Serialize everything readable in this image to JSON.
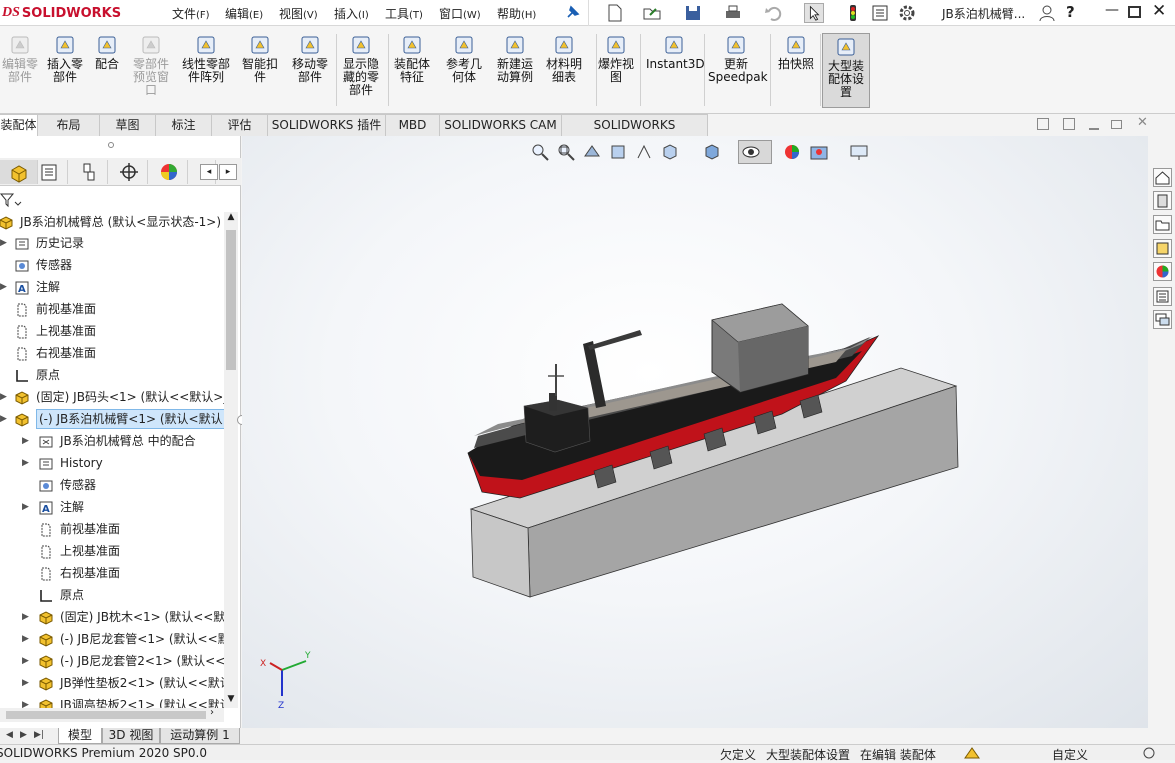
{
  "app": {
    "logo_ds": "DS",
    "logo_name": "SOLIDWORKS",
    "window_title": "JB系泊机械臂..."
  },
  "menus": [
    {
      "label": "文件",
      "key": "(F)"
    },
    {
      "label": "编辑",
      "key": "(E)"
    },
    {
      "label": "视图",
      "key": "(V)"
    },
    {
      "label": "插入",
      "key": "(I)"
    },
    {
      "label": "工具",
      "key": "(T)"
    },
    {
      "label": "窗口",
      "key": "(W)"
    },
    {
      "label": "帮助",
      "key": "(H)"
    }
  ],
  "ribbon": [
    {
      "label": "编辑零\n部件",
      "icon": "edit-component-icon",
      "disabled": true
    },
    {
      "label": "插入零\n部件",
      "icon": "insert-component-icon"
    },
    {
      "label": "配合",
      "icon": "mate-icon"
    },
    {
      "label": "零部件\n预览窗\n口",
      "icon": "component-preview-icon",
      "disabled": true
    },
    {
      "label": "线性零部\n件阵列",
      "icon": "linear-pattern-icon"
    },
    {
      "label": "智能扣\n件",
      "icon": "smart-fastener-icon"
    },
    {
      "label": "移动零\n部件",
      "icon": "move-component-icon"
    },
    {
      "label": "显示隐\n藏的零\n部件",
      "icon": "show-hidden-icon"
    },
    {
      "label": "装配体\n特征",
      "icon": "assembly-feature-icon"
    },
    {
      "label": "参考几\n何体",
      "icon": "reference-geometry-icon"
    },
    {
      "label": "新建运\n动算例",
      "icon": "motion-study-icon"
    },
    {
      "label": "材料明\n细表",
      "icon": "bom-icon"
    },
    {
      "label": "爆炸视\n图",
      "icon": "exploded-view-icon"
    },
    {
      "label": "Instant3D",
      "icon": "instant3d-icon"
    },
    {
      "label": "更新\nSpeedpak",
      "icon": "speedpak-icon"
    },
    {
      "label": "拍快照",
      "icon": "snapshot-icon"
    },
    {
      "label": "大型装\n配体设\n置",
      "icon": "large-assembly-icon",
      "selected": true
    }
  ],
  "tabs": [
    "装配体",
    "布局",
    "草图",
    "标注",
    "评估",
    "SOLIDWORKS 插件",
    "MBD",
    "SOLIDWORKS CAM",
    "SOLIDWORKS Inspection"
  ],
  "tree": {
    "root": "JB系泊机械臂总  (默认<显示状态-1>)",
    "items": [
      "历史记录",
      "传感器",
      "注解",
      "前视基准面",
      "上视基准面",
      "右视基准面",
      "原点",
      "(固定) JB码头<1> (默认<<默认>_",
      "(-) JB系泊机械臂<1> (默认<默认",
      "JB系泊机械臂总 中的配合",
      "History",
      "传感器",
      "注解",
      "前视基准面",
      "上视基准面",
      "右视基准面",
      "原点",
      "(固定) JB枕木<1> (默认<<默",
      "(-) JB尼龙套管<1> (默认<<默",
      "(-) JB尼龙套管2<1> (默认<<",
      "JB弹性垫板2<1> (默认<<默认",
      "JB调高垫板2<1> (默认<<默认"
    ]
  },
  "bottom_tabs": [
    "模型",
    "3D 视图",
    "运动算例 1"
  ],
  "status": {
    "product": "SOLIDWORKS Premium 2020 SP0.0",
    "s1": "欠定义",
    "s2": "大型装配体设置",
    "s3": "在编辑 装配体",
    "s4": "自定义"
  },
  "triad": {
    "x": "X",
    "y": "Y",
    "z": "Z"
  },
  "colors": {
    "brand": "#c8102e",
    "hull_red": "#c0121a",
    "hull_black": "#1a1a1a",
    "dock_grey": "#bdbdbd"
  }
}
